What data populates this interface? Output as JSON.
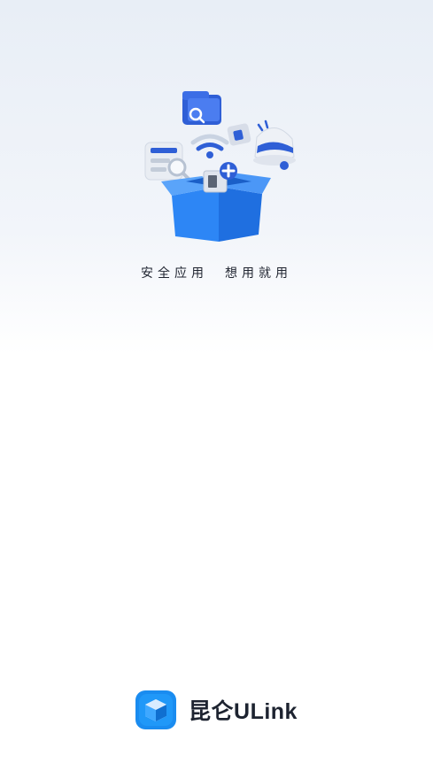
{
  "splash": {
    "illustration_icon": "open-box-with-app-icons",
    "tagline": "安全应用  想用就用"
  },
  "brand": {
    "logo_icon": "cube-logo-icon",
    "name": "昆仑ULink",
    "accent_color": "#1a8cf0"
  },
  "colors": {
    "box_blue": "#2d86f5",
    "icon_blue": "#2f5fd6",
    "background_top": "#e8eef6",
    "background_bottom": "#ffffff"
  }
}
